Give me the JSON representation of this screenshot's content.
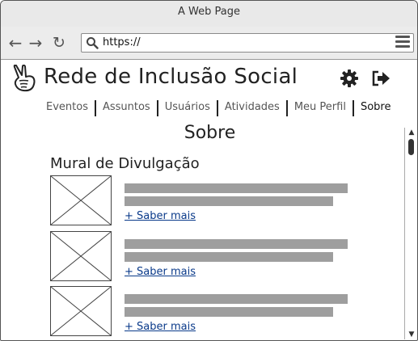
{
  "window": {
    "title": "A Web Page"
  },
  "browser": {
    "url": "https://",
    "back_icon": "arrow-left-icon",
    "forward_icon": "arrow-right-icon",
    "reload_icon": "reload-icon",
    "menu_icon": "hamburger-menu-icon"
  },
  "app": {
    "title": "Rede de Inclusão Social"
  },
  "nav": {
    "items": [
      "Eventos",
      "Assuntos",
      "Usuários",
      "Atividades",
      "Meu Perfil",
      "Sobre"
    ],
    "active": "Sobre"
  },
  "page": {
    "title": "Sobre",
    "section_title": "Mural de Divulgação"
  },
  "posts": [
    {
      "link": "+ Saber mais"
    },
    {
      "link": "+ Saber mais"
    },
    {
      "link": "+ Saber mais"
    }
  ],
  "colors": {
    "link": "#0a3a8a",
    "placeholder_bar": "#9e9e9e"
  }
}
